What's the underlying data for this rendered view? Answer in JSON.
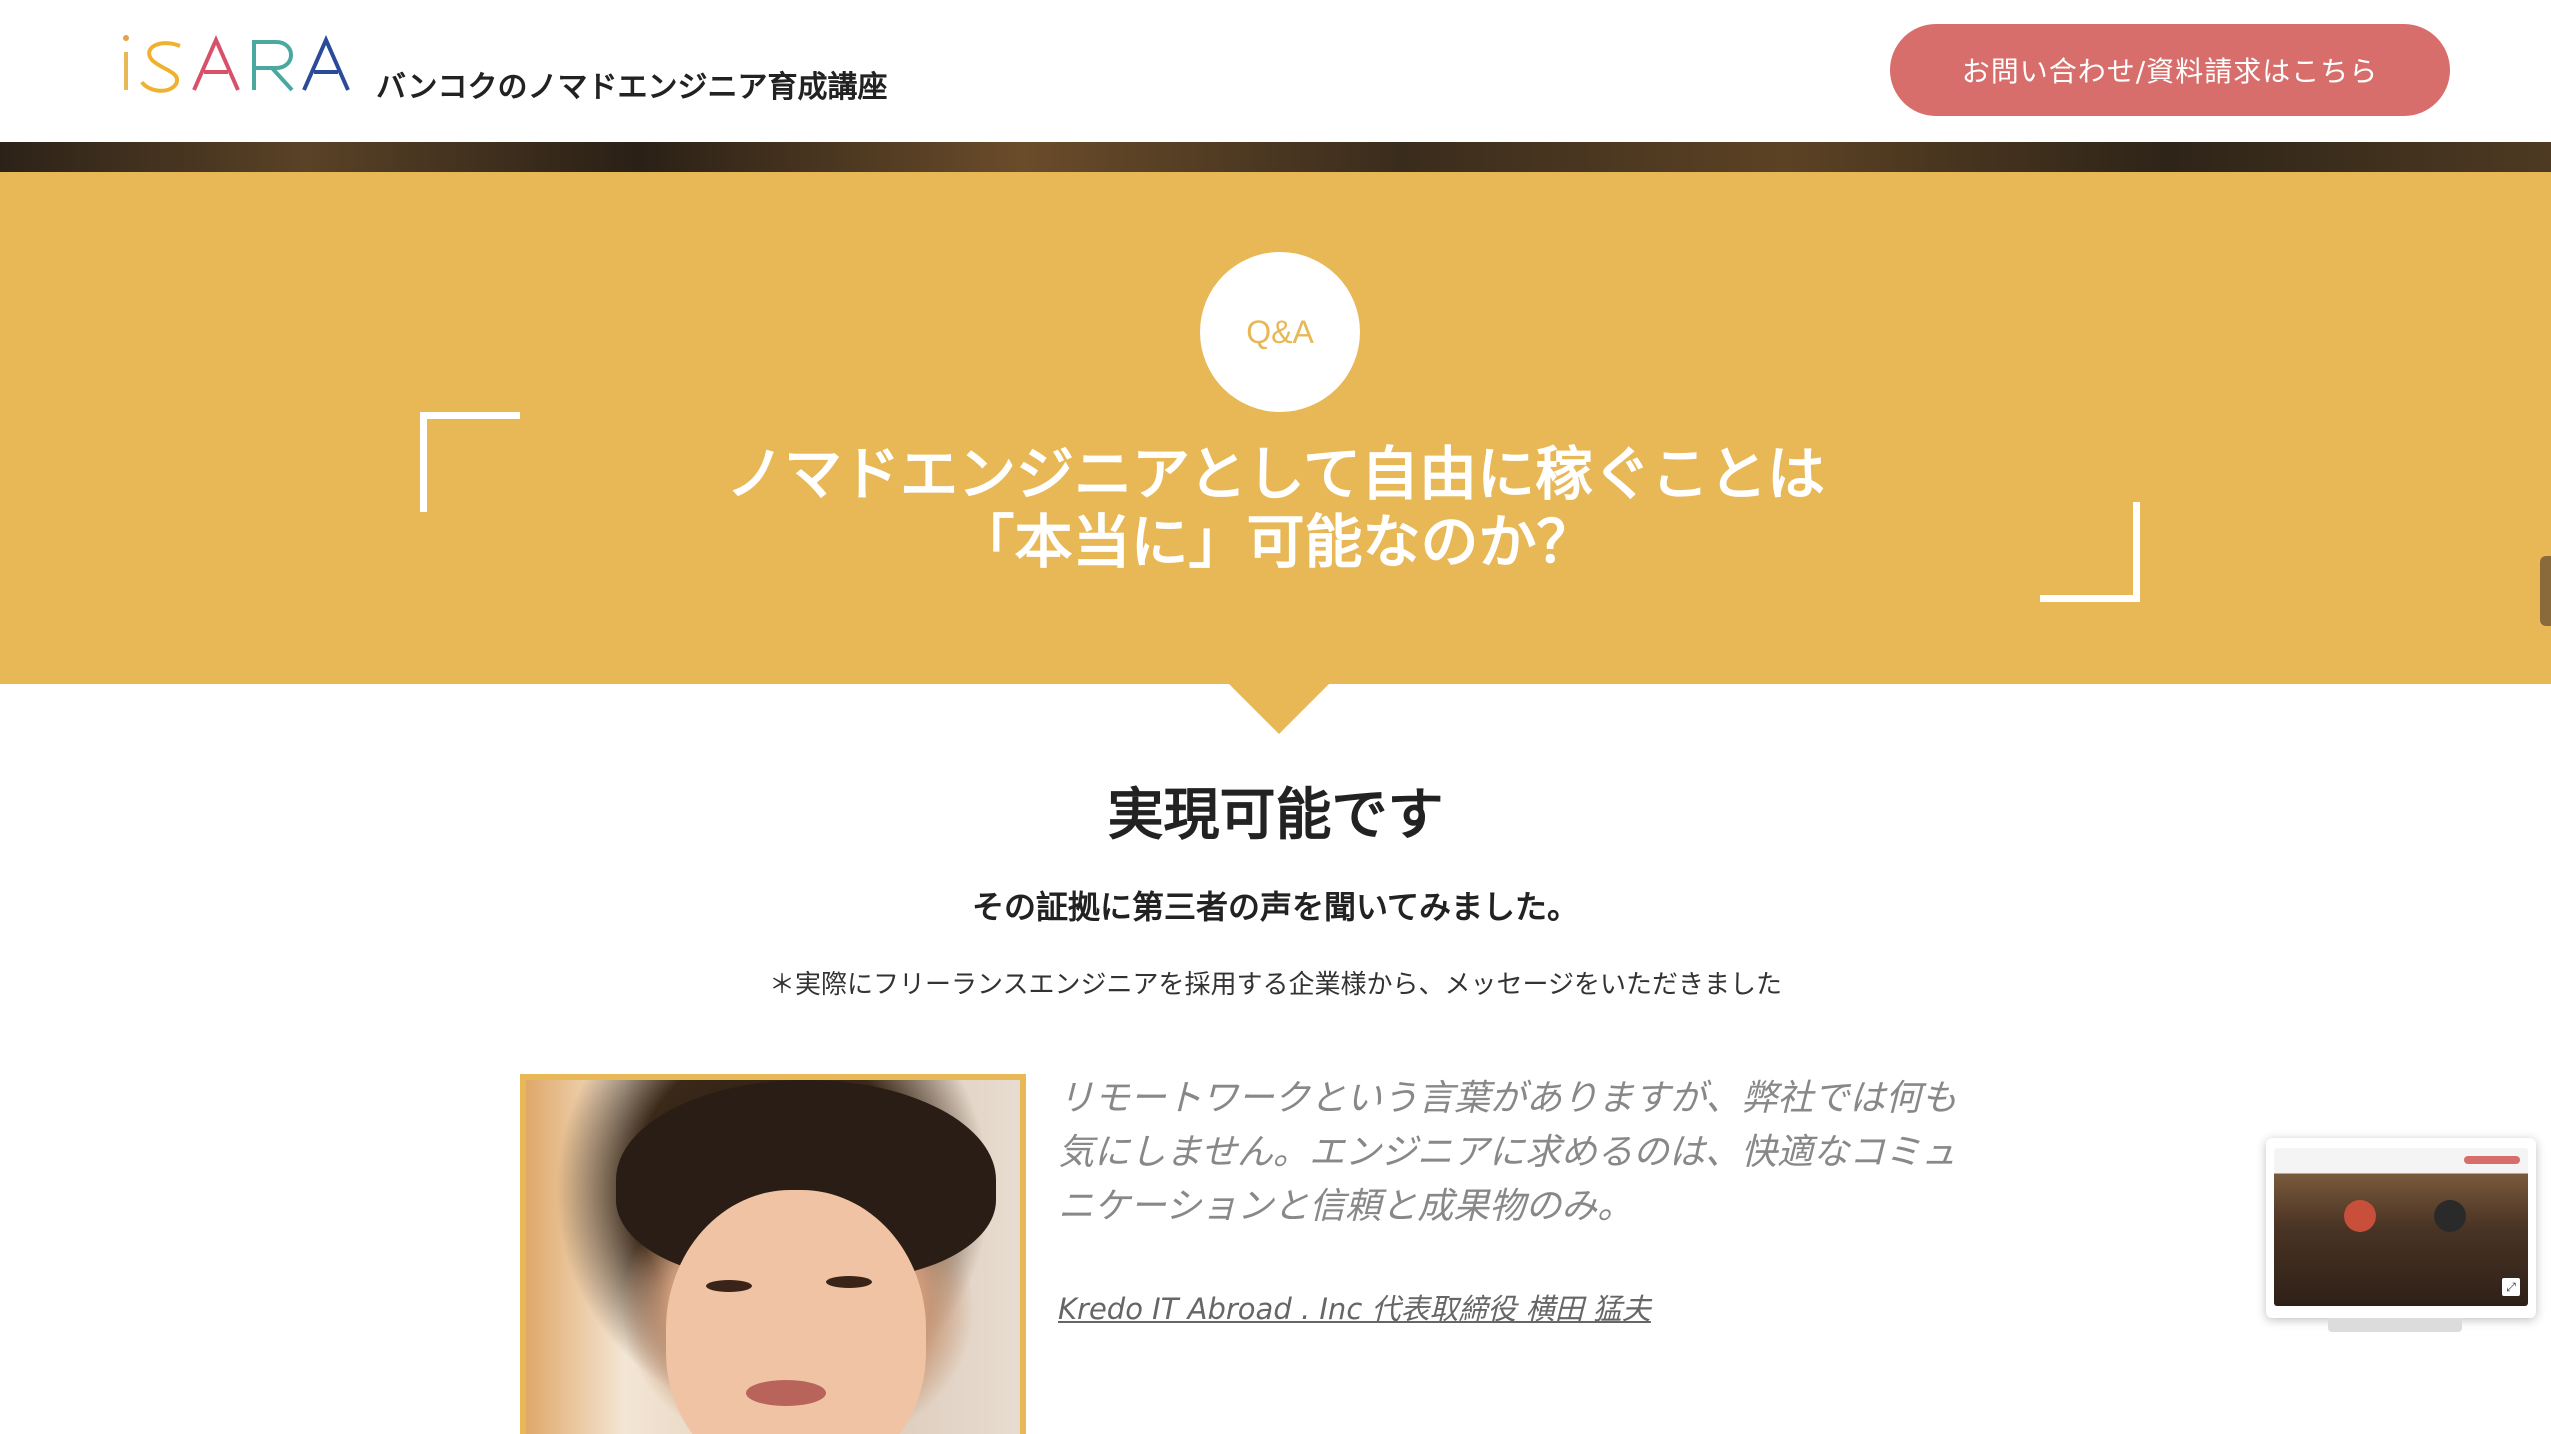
{
  "header": {
    "logo_text": "iSARA",
    "tagline": "バンコクのノマドエンジニア育成講座",
    "cta_label": "お問い合わせ/資料請求はこちら"
  },
  "qa": {
    "badge": "Q&A",
    "title_line1": "ノマドエンジニアとして自由に稼ぐことは",
    "title_line2": "「本当に」可能なのか？"
  },
  "answer": {
    "title": "実現可能です",
    "subtitle": "その証拠に第三者の声を聞いてみました。",
    "note": "＊実際にフリーランスエンジニアを採用する企業様から、メッセージをいただきました"
  },
  "testimonial": {
    "quote": "リモートワークという言葉がありますが、弊社では何も気にしません。エンジニアに求めるのは、快適なコミュニケーションと信頼と成果物のみ。",
    "author": "Kredo IT Abroad . Inc 代表取締役 横田 猛夫"
  },
  "colors": {
    "accent_yellow": "#e8b756",
    "cta_red": "#d86e6b"
  }
}
